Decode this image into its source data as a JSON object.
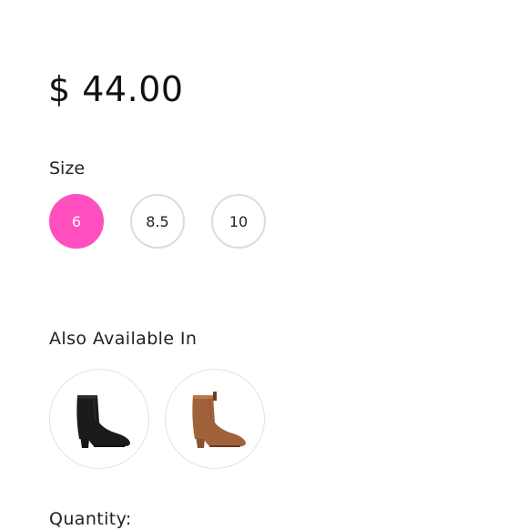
{
  "product": {
    "price": "$ 44.00"
  },
  "size": {
    "label": "Size",
    "options": [
      "6",
      "8.5",
      "10"
    ],
    "selected": "6",
    "accent_color": "#ff4fbf"
  },
  "variants": {
    "label": "Also Available In",
    "items": [
      {
        "icon": "black-bootie-image",
        "color": "#1b1b1b"
      },
      {
        "icon": "tan-bootie-image",
        "color": "#a0623a"
      }
    ]
  },
  "quantity": {
    "label": "Quantity:"
  }
}
